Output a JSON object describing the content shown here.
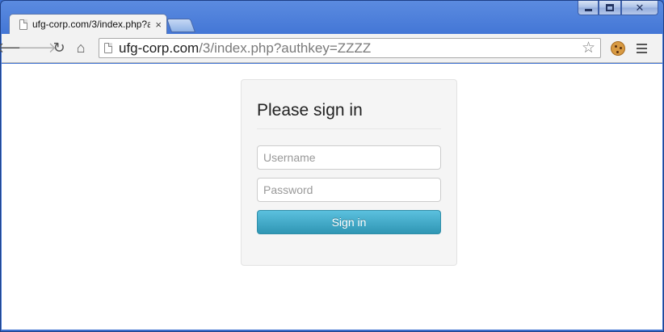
{
  "browser": {
    "tab_title": "ufg-corp.com/3/index.php?a",
    "tab_close": "×",
    "url_host": "ufg-corp.com",
    "url_path": "/3/index.php?authkey=ZZZZ",
    "back_glyph": "🡐",
    "forward_glyph": "🡒",
    "reload_glyph": "↻",
    "home_glyph": "⌂",
    "star_glyph": "☆",
    "close_glyph": "✕"
  },
  "icons": {
    "back": "back-arrow-icon",
    "forward": "forward-arrow-icon",
    "reload": "reload-icon",
    "home": "home-icon",
    "star": "star-icon",
    "cookie": "cookie-icon",
    "menu": "menu-icon"
  },
  "form": {
    "heading": "Please sign in",
    "username_placeholder": "Username",
    "password_placeholder": "Password",
    "submit_label": "Sign in"
  },
  "colors": {
    "button_top": "#5bc0de",
    "button_bottom": "#2f96b4",
    "window_frame": "#4477d6"
  }
}
